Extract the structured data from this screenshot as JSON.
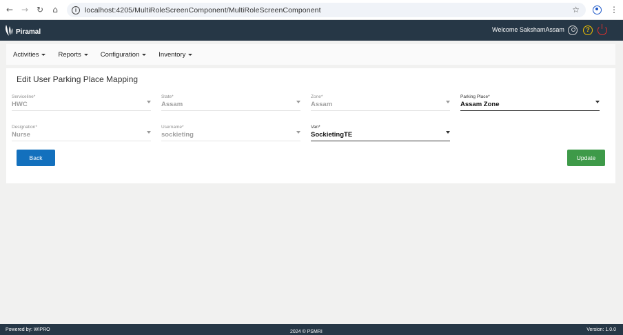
{
  "browser": {
    "url": "localhost:4205/MultiRoleScreenComponent/MultiRoleScreenComponent",
    "back_icon": "arrow-left-icon",
    "forward_icon": "arrow-right-icon",
    "reload_icon": "reload-icon",
    "home_icon": "home-icon"
  },
  "header": {
    "brand": "Piramal",
    "welcome": "Welcome SakshamAssam",
    "help_glyph": "?"
  },
  "menu": {
    "items": [
      {
        "label": "Activities"
      },
      {
        "label": "Reports"
      },
      {
        "label": "Configuration"
      },
      {
        "label": "Inventory"
      }
    ]
  },
  "form": {
    "title": "Edit User Parking Place Mapping",
    "fields": {
      "serviceline": {
        "label": "Serviceline*",
        "value": "HWC"
      },
      "state": {
        "label": "State*",
        "value": "Assam"
      },
      "zone": {
        "label": "Zone*",
        "value": "Assam"
      },
      "parking_place": {
        "label": "Parking Place*",
        "value": "Assam Zone"
      },
      "designation": {
        "label": "Designation*",
        "value": "Nurse"
      },
      "username": {
        "label": "Username*",
        "value": "sockieting"
      },
      "van": {
        "label": "Van*",
        "value": "SockietingTE"
      }
    },
    "back_label": "Back",
    "update_label": "Update"
  },
  "footer": {
    "powered_by": "Powered by: WIPRO",
    "copyright": "2024 © PSMRI",
    "version": "Version: 1.0.0"
  },
  "colors": {
    "header_bg": "#263746",
    "back_button": "#1370bd",
    "update_button": "#3e9a49"
  }
}
